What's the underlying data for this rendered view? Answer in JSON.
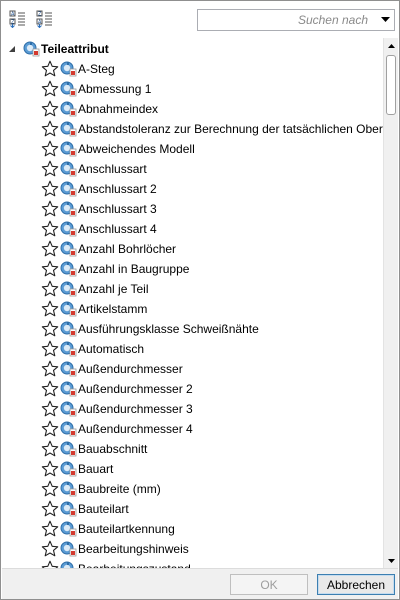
{
  "toolbar": {
    "buttons": [
      {
        "icon": "sort-ascending-icon"
      },
      {
        "icon": "sort-descending-icon"
      }
    ],
    "search": {
      "placeholder": "Suchen nach",
      "value": ""
    }
  },
  "tree": {
    "root": {
      "label": "Teileattribut",
      "expanded": true
    },
    "items": [
      {
        "label": "A-Steg"
      },
      {
        "label": "Abmessung 1"
      },
      {
        "label": "Abnahmeindex"
      },
      {
        "label": "Abstandstoleranz zur Berechnung der tatsächlichen Oberfl"
      },
      {
        "label": "Abweichendes Modell"
      },
      {
        "label": "Anschlussart"
      },
      {
        "label": "Anschlussart 2"
      },
      {
        "label": "Anschlussart 3"
      },
      {
        "label": "Anschlussart 4"
      },
      {
        "label": "Anzahl Bohrlöcher"
      },
      {
        "label": "Anzahl in Baugruppe"
      },
      {
        "label": "Anzahl je Teil"
      },
      {
        "label": "Artikelstamm"
      },
      {
        "label": "Ausführungsklasse Schweißnähte"
      },
      {
        "label": "Automatisch"
      },
      {
        "label": "Außendurchmesser"
      },
      {
        "label": "Außendurchmesser 2"
      },
      {
        "label": "Außendurchmesser 3"
      },
      {
        "label": "Außendurchmesser 4"
      },
      {
        "label": "Bauabschnitt"
      },
      {
        "label": "Bauart"
      },
      {
        "label": "Baubreite (mm)"
      },
      {
        "label": "Bauteilart"
      },
      {
        "label": "Bauteilartkennung"
      },
      {
        "label": "Bearbeitungshinweis"
      },
      {
        "label": "Bearbeitungszustand"
      }
    ]
  },
  "footer": {
    "ok_label": "OK",
    "ok_enabled": false,
    "cancel_label": "Abbrechen"
  },
  "colors": {
    "attr_icon_blue": "#4a90c8",
    "attr_icon_red": "#d43a2f",
    "focus_border": "#3c7fb1"
  }
}
